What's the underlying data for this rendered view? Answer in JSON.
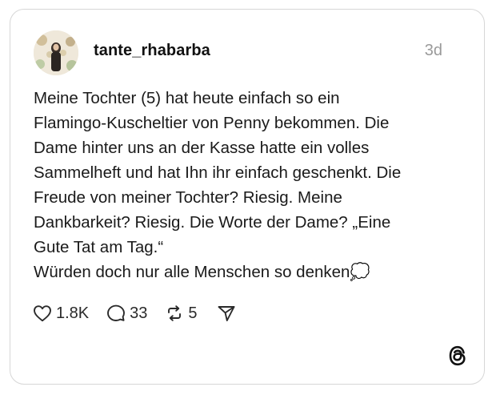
{
  "post": {
    "username": "tante_rhabarba",
    "timestamp": "3d",
    "body_lines": [
      "Meine Tochter (5) hat heute einfach so ein",
      "Flamingo-Kuscheltier von Penny bekommen. Die",
      "Dame hinter uns an der Kasse hatte ein volles",
      "Sammelheft und hat Ihn ihr einfach geschenkt. Die",
      "Freude von meiner Tochter? Riesig. Meine",
      "Dankbarkeit? Riesig. Die Worte der Dame? „Eine",
      "Gute Tat am Tag.“",
      "Würden doch nur alle Menschen so denken💭"
    ]
  },
  "actions": {
    "like_count": "1.8K",
    "reply_count": "33",
    "repost_count": "5"
  },
  "icons": {
    "avatar": "avatar-photo",
    "like": "heart-icon",
    "reply": "speech-bubble-icon",
    "repost": "repost-arrows-icon",
    "share": "paper-plane-icon",
    "brand": "threads-logo-icon"
  },
  "colors": {
    "text": "#1a1a1a",
    "muted": "#9a9a9a",
    "border": "#d6d6d6"
  }
}
